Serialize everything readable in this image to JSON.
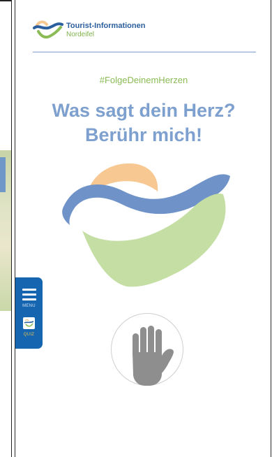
{
  "brand": {
    "name_line1": "Tourist-Informationen",
    "name_line2": "Nordeifel"
  },
  "hashtag": "#FolgeDeinemHerzen",
  "headline": {
    "line1": "Was sagt dein Herz?",
    "line2": "Berühr mich!"
  },
  "sidebar": {
    "menu_label": "MENU",
    "quiz_label": "QUIZ"
  },
  "colors": {
    "brand_blue": "#2c5f9e",
    "heart_blue": "#6f93c9",
    "heart_orange": "#f7c891",
    "heart_green": "#c4dea4",
    "headline_blue": "#7da0cf",
    "hashtag_green": "#8bbb55",
    "sidebar_blue": "#1565b0"
  },
  "icons": {
    "logo": "heart-wave-logo-icon",
    "hand": "hand-touch-icon",
    "menu": "hamburger-menu-icon",
    "quiz": "quiz-icon"
  }
}
